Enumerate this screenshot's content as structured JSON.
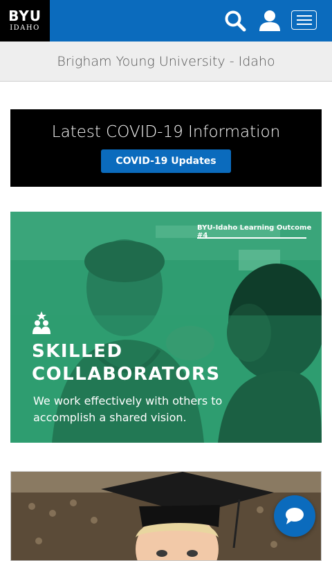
{
  "header": {
    "logo_main": "BYU",
    "logo_sub": "IDAHO",
    "icons": [
      "search-icon",
      "user-icon",
      "hamburger-menu-icon"
    ],
    "brand_color": "#0b6bbd"
  },
  "site_title": "Brigham Young University - Idaho",
  "covid": {
    "heading": "Latest COVID-19 Information",
    "button_label": "COVID-19 Updates"
  },
  "banner": {
    "tag": "BYU-Idaho Learning Outcome #4",
    "heading_line1": "SKILLED",
    "heading_line2": "COLLABORATORS",
    "text": "We work effectively with others to accomplish a shared vision.",
    "accent_color": "#2f9d71"
  },
  "chat": {
    "icon": "chat-bubble-icon"
  }
}
